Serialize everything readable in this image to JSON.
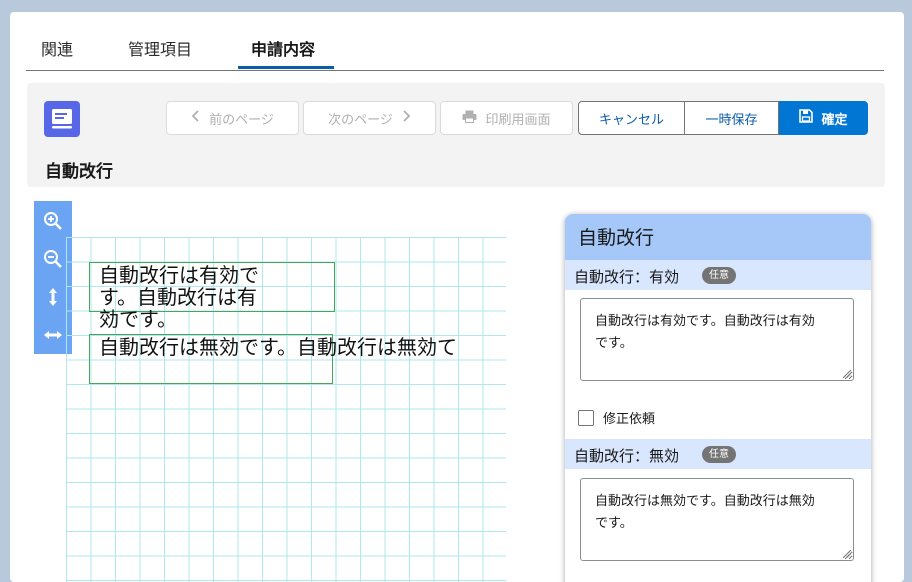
{
  "tabs": [
    {
      "label": "関連"
    },
    {
      "label": "管理項目"
    },
    {
      "label": "申請内容"
    }
  ],
  "header": {
    "title": "自動改行",
    "prev_label": "前のページ",
    "next_label": "次のページ",
    "print_label": "印刷用画面",
    "cancel_label": "キャンセル",
    "save_label": "一時保存",
    "confirm_label": "確定"
  },
  "canvas": {
    "field1_text": [
      "自動改行は有効で",
      "す。自動改行は有",
      "効です。"
    ],
    "field2_text": "自動改行は無効です。自動改行は無効て"
  },
  "side": {
    "title": "自動改行",
    "section1": {
      "label": "自動改行：有効",
      "badge": "任意",
      "value_lines": [
        "自動改行は有効です。自動改行は有効",
        "です。"
      ]
    },
    "checkbox_label": "修正依頼",
    "section2": {
      "label": "自動改行：無効",
      "badge": "任意",
      "value_lines": [
        "自動改行は無効です。自動改行は無効",
        "です。"
      ]
    }
  },
  "colors": {
    "brand": "#0176d3",
    "record_icon": "#5867e8",
    "zoom_bar": "#6ba4f2",
    "field_border": "#4aa55a"
  },
  "icons": [
    "record-icon",
    "chevron-left-icon",
    "chevron-right-icon",
    "printer-icon",
    "save-icon",
    "zoom-in-icon",
    "zoom-out-icon",
    "fit-height-icon",
    "fit-width-icon"
  ]
}
